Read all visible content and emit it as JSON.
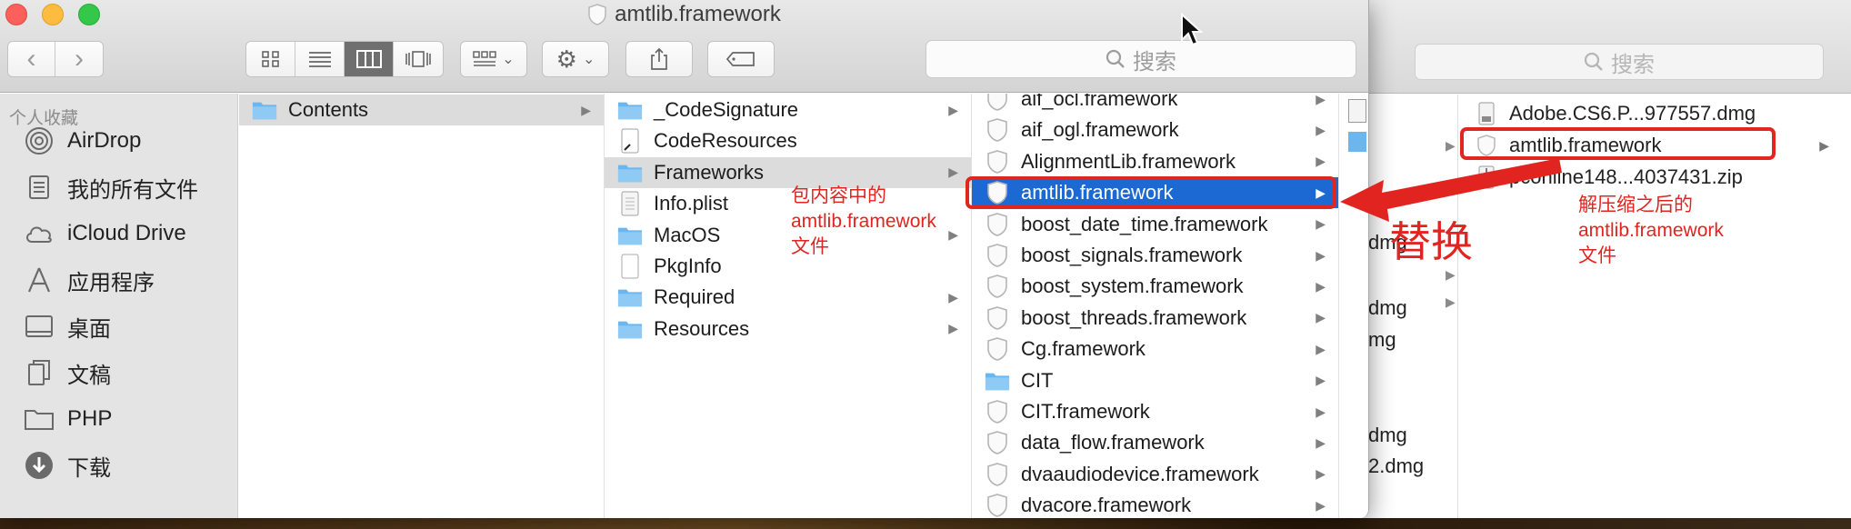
{
  "window": {
    "title": "amtlib.framework",
    "search_placeholder": "搜索"
  },
  "sidebar": {
    "heading": "个人收藏",
    "items": [
      {
        "label": "AirDrop",
        "icon": "airdrop-icon"
      },
      {
        "label": "我的所有文件",
        "icon": "all-files-icon"
      },
      {
        "label": "iCloud Drive",
        "icon": "cloud-icon"
      },
      {
        "label": "应用程序",
        "icon": "applications-icon"
      },
      {
        "label": "桌面",
        "icon": "desktop-icon"
      },
      {
        "label": "文稿",
        "icon": "documents-icon"
      },
      {
        "label": "PHP",
        "icon": "folder-icon"
      },
      {
        "label": "下载",
        "icon": "download-icon"
      }
    ]
  },
  "columns": {
    "col1": [
      {
        "label": "Contents",
        "type": "folder",
        "arrow": true,
        "selected": "gray"
      }
    ],
    "col2": [
      {
        "label": "_CodeSignature",
        "type": "folder",
        "arrow": true
      },
      {
        "label": "CodeResources",
        "type": "alias",
        "arrow": false
      },
      {
        "label": "Frameworks",
        "type": "folder",
        "arrow": true,
        "selected": "gray"
      },
      {
        "label": "Info.plist",
        "type": "plist",
        "arrow": false
      },
      {
        "label": "MacOS",
        "type": "folder",
        "arrow": true
      },
      {
        "label": "PkgInfo",
        "type": "file",
        "arrow": false
      },
      {
        "label": "Required",
        "type": "folder",
        "arrow": true
      },
      {
        "label": "Resources",
        "type": "folder",
        "arrow": true
      }
    ],
    "col3": [
      {
        "label": "aif_ocl.framework",
        "type": "framework",
        "arrow": true
      },
      {
        "label": "aif_ogl.framework",
        "type": "framework",
        "arrow": true
      },
      {
        "label": "AlignmentLib.framework",
        "type": "framework",
        "arrow": true
      },
      {
        "label": "amtlib.framework",
        "type": "framework",
        "arrow": true,
        "selected": "blue"
      },
      {
        "label": "boost_date_time.framework",
        "type": "framework",
        "arrow": true
      },
      {
        "label": "boost_signals.framework",
        "type": "framework",
        "arrow": true
      },
      {
        "label": "boost_system.framework",
        "type": "framework",
        "arrow": true
      },
      {
        "label": "boost_threads.framework",
        "type": "framework",
        "arrow": true
      },
      {
        "label": "Cg.framework",
        "type": "framework",
        "arrow": true
      },
      {
        "label": "CIT",
        "type": "folder",
        "arrow": true
      },
      {
        "label": "CIT.framework",
        "type": "framework",
        "arrow": true
      },
      {
        "label": "data_flow.framework",
        "type": "framework",
        "arrow": true
      },
      {
        "label": "dvaaudiodevice.framework",
        "type": "framework",
        "arrow": true
      },
      {
        "label": "dvacore.framework",
        "type": "framework",
        "arrow": true
      }
    ]
  },
  "back_window": {
    "search_placeholder": "搜索",
    "left_fragments": [
      "dmg",
      "dmg",
      "mg",
      "dmg",
      "2.dmg"
    ],
    "items": [
      {
        "label": "Adobe.CS6.P...977557.dmg",
        "type": "disk-image"
      },
      {
        "label": "amtlib.framework",
        "type": "framework"
      },
      {
        "label": "pconline148...4037431.zip",
        "type": "zip"
      }
    ]
  },
  "annotations": {
    "left_note": [
      "包内容中的",
      "amtlib.framework",
      "文件"
    ],
    "right_note": [
      "解压缩之后的",
      "amtlib.framework",
      "文件"
    ],
    "replace_label": "替换",
    "color": "#e1241f"
  },
  "colors": {
    "selection_blue": "#1c69d4",
    "folder_blue": "#6cb6ef",
    "annotation_red": "#e1241f"
  }
}
